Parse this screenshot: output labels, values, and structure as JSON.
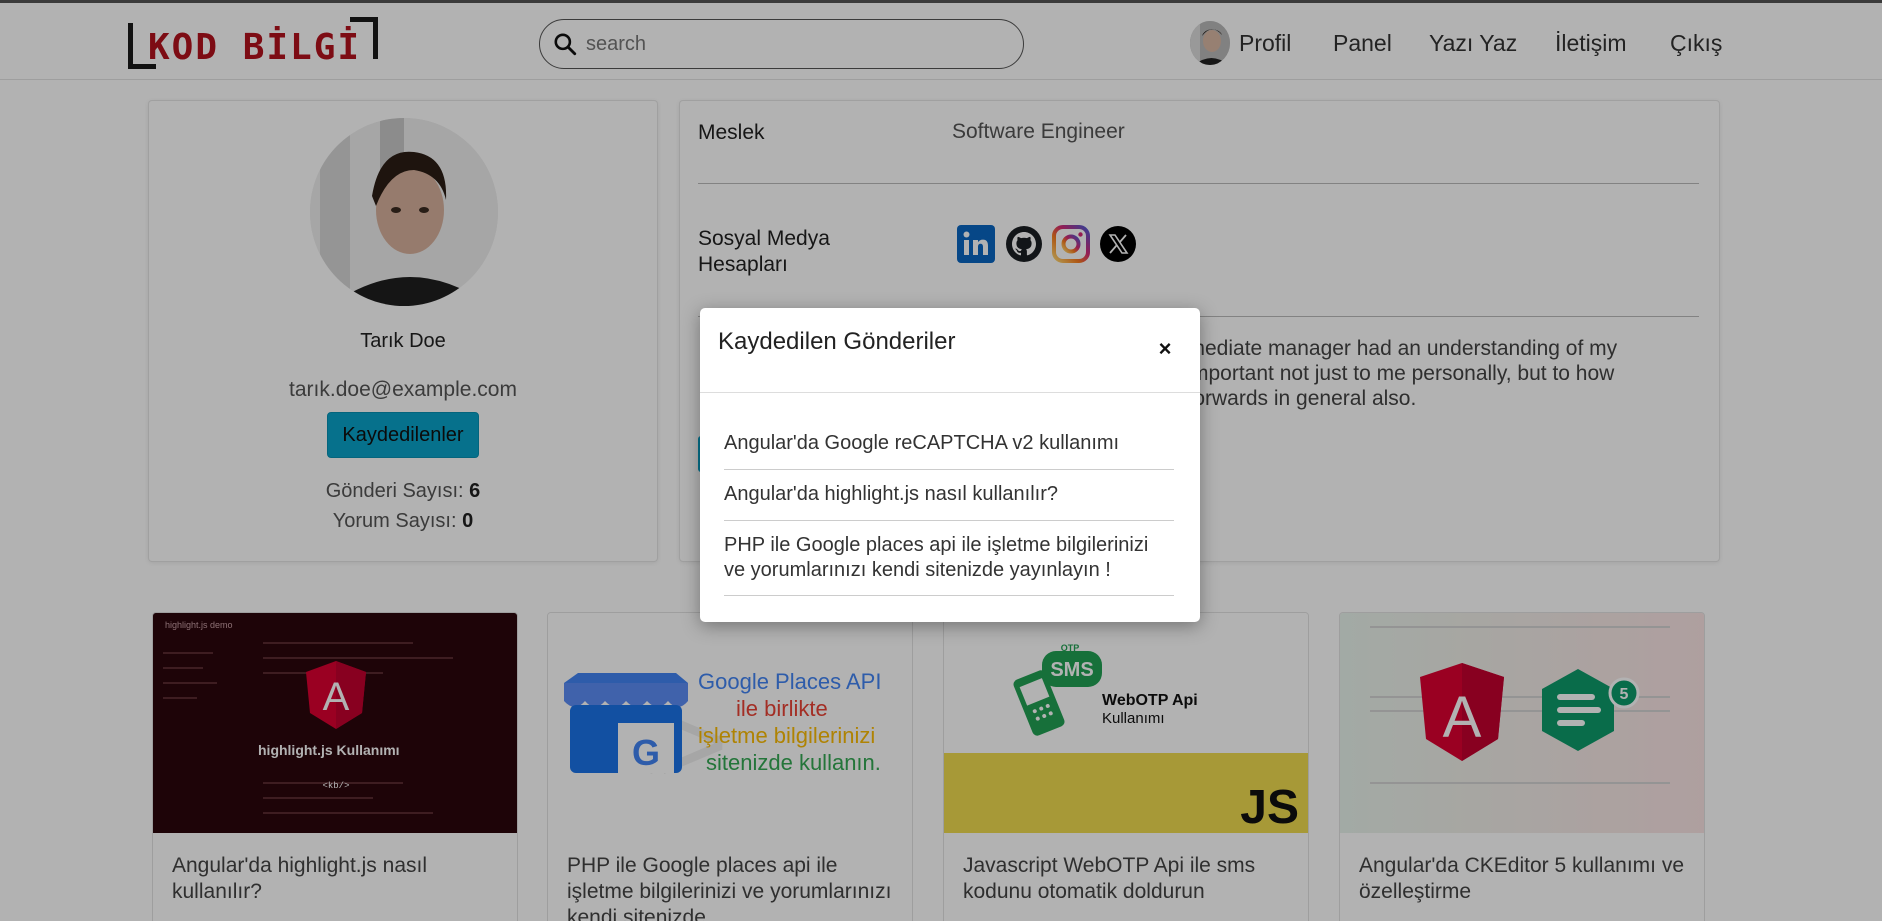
{
  "header": {
    "logo_text": "KOD BİLGİ",
    "search_placeholder": "search",
    "nav": {
      "profile": "Profil",
      "panel": "Panel",
      "write": "Yazı Yaz",
      "contact": "İletişim",
      "logout": "Çıkış"
    }
  },
  "profile": {
    "name": "Tarık Doe",
    "email": "tarık.doe@example.com",
    "saved_button": "Kaydedilenler",
    "posts_label": "Gönderi Sayısı:",
    "posts_count": "6",
    "comments_label": "Yorum Sayısı:",
    "comments_count": "0"
  },
  "details": {
    "job_label": "Meslek",
    "job_value": "Software Engineer",
    "social_label_line1": "Sosyal Medya",
    "social_label_line2": "Hesapları",
    "social_icons": [
      "linkedin-icon",
      "github-icon",
      "instagram-icon",
      "x-twitter-icon"
    ],
    "bio_line1": "mmediate manager had an understanding of my",
    "bio_line2": "s important not just to me personally, but to how",
    "bio_line3": "e forwards in general also."
  },
  "posts": [
    {
      "title": "Angular'da highlight.js nasıl kullanılır?",
      "thumb_text": "highlight.js Kullanımı",
      "thumb_sub": "<kb/>",
      "thumb_header": "highlight.js demo"
    },
    {
      "title": "PHP ile Google places api ile işletme bilgilerinizi ve yorumlarınızı kendi sitenizde",
      "thumb_line1": "Google Places API",
      "thumb_line2": "ile birlikte",
      "thumb_line3": "işletme bilgilerinizi",
      "thumb_line4": "sitenizde kullanın."
    },
    {
      "title": "Javascript WebOTP Api ile sms kodunu otomatik doldurun",
      "thumb_line1": "WebOTP Api",
      "thumb_line2": "Kullanımı",
      "thumb_badge": "SMS",
      "thumb_otp": "OTP",
      "thumb_js": "JS"
    },
    {
      "title": "Angular'da CKEditor 5 kullanımı ve özelleştirme",
      "thumb_badge": "5"
    }
  ],
  "modal": {
    "title": "Kaydedilen Gönderiler",
    "close": "×",
    "items": [
      "Angular'da Google reCAPTCHA v2 kullanımı",
      "Angular'da highlight.js nasıl kullanılır?",
      "PHP ile Google places api ile işletme bilgilerinizi ve yorumlarınızı kendi sitenizde yayınlayın !"
    ]
  },
  "colors": {
    "brand_red": "#b3121d",
    "button_cyan": "#0aa2c9",
    "js_yellow": "#f0db4f",
    "angular_red": "#dd0031",
    "ck_green": "#0e9b6a"
  }
}
